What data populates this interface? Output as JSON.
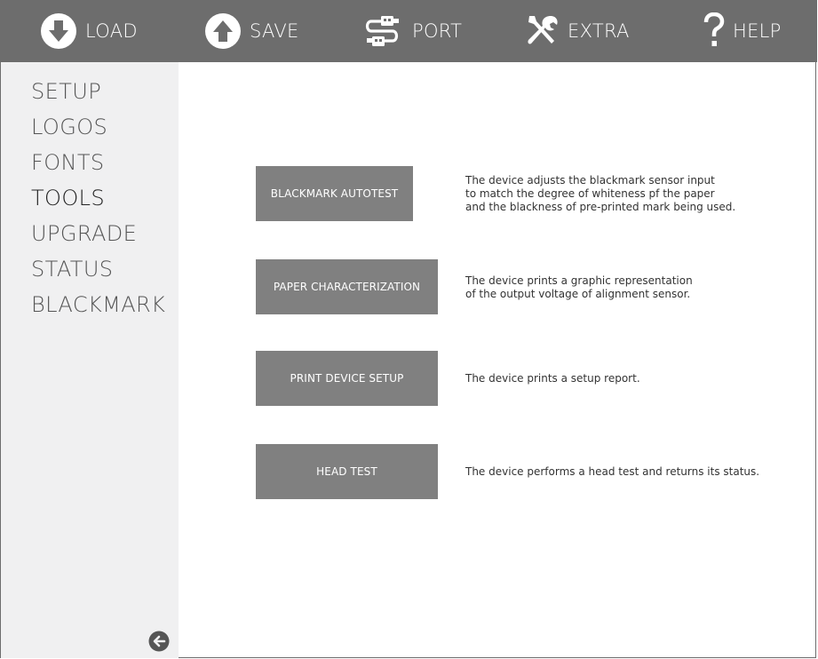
{
  "toolbar": {
    "load_label": "LOAD",
    "save_label": "SAVE",
    "port_label": "PORT",
    "extra_label": "EXTRA",
    "help_label": "HELP"
  },
  "sidebar": {
    "items": [
      {
        "label": "SETUP",
        "active": false
      },
      {
        "label": "LOGOS",
        "active": false
      },
      {
        "label": "FONTS",
        "active": false
      },
      {
        "label": "TOOLS",
        "active": true
      },
      {
        "label": "UPGRADE",
        "active": false
      },
      {
        "label": "STATUS",
        "active": false
      },
      {
        "label": "BLACKMARK",
        "active": false
      }
    ],
    "back_icon": "arrow-left-circle-icon"
  },
  "tools": [
    {
      "button": "BLACKMARK AUTOTEST",
      "description": "The device adjusts the blackmark sensor input\nto match the degree of whiteness pf the paper\nand the blackness of pre-printed mark being used."
    },
    {
      "button": "PAPER CHARACTERIZATION",
      "description": "The device prints a graphic representation\nof the output voltage of alignment sensor."
    },
    {
      "button": "PRINT DEVICE SETUP",
      "description": "The device prints a setup report."
    },
    {
      "button": "HEAD TEST",
      "description": "The device performs a head test and returns its status."
    }
  ],
  "colors": {
    "toolbar_bg": "#6d6d6d",
    "sidebar_bg": "#f0f0f1",
    "button_bg": "#808080"
  }
}
